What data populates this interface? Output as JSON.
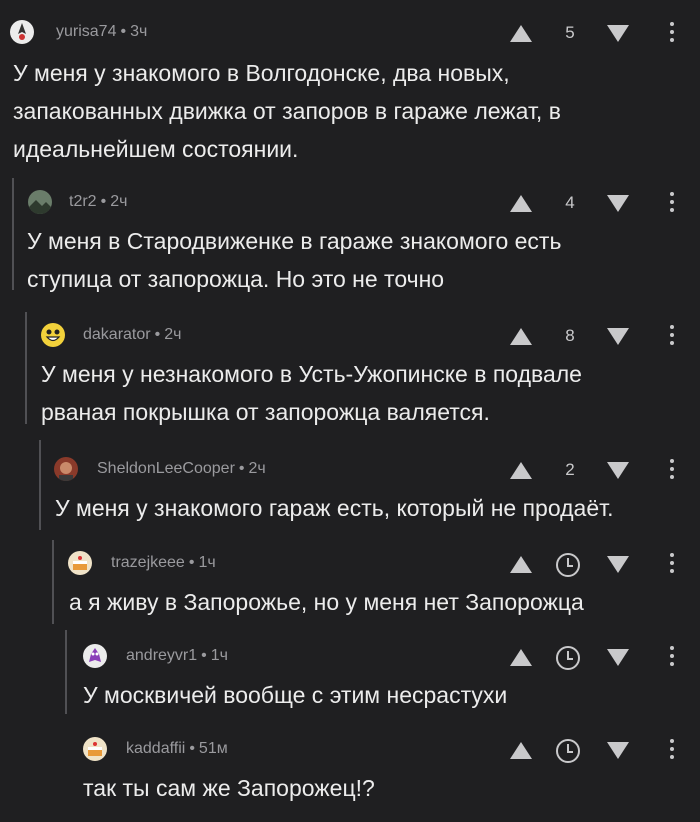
{
  "comments": [
    {
      "author": "yurisa74",
      "time": "3ч",
      "score": "5",
      "text_lines": [
        "У меня у знакомого в Волгодонске, два новых,",
        "запакованных движка от запоров в гараже лежат, в",
        "идеальнейшем состоянии."
      ],
      "avatar_icon": "rocket-avatar-icon"
    },
    {
      "author": "t2r2",
      "time": "2ч",
      "score": "4",
      "text_lines": [
        "У меня в Стародвиженке в гараже знакомого есть",
        "ступица от запорожца. Но это не точно"
      ],
      "avatar_icon": "landscape-avatar-icon"
    },
    {
      "author": "dakarator",
      "time": "2ч",
      "score": "8",
      "text_lines": [
        "У меня у незнакомого в Усть-Ужопинске в подвале",
        "рваная покрышка от запорожца валяется."
      ],
      "avatar_icon": "smiley-avatar-icon"
    },
    {
      "author": "SheldonLeeCooper",
      "time": "2ч",
      "score": "2",
      "text_lines": [
        "У меня у знакомого гараж есть, который не продаёт."
      ],
      "avatar_icon": "face-avatar-icon"
    },
    {
      "author": "trazejkeee",
      "time": "1ч",
      "score": "",
      "text_lines": [
        "а я живу в Запорожье, но у меня нет Запорожца"
      ],
      "avatar_icon": "cake-avatar-icon"
    },
    {
      "author": "andreyvr1",
      "time": "1ч",
      "score": "",
      "text_lines": [
        "У москвичей вообще с этим несрастухи"
      ],
      "avatar_icon": "purple-creature-avatar-icon"
    },
    {
      "author": "kaddaffii",
      "time": "51м",
      "score": "",
      "text_lines": [
        "так ты сам же Запорожец!?"
      ],
      "avatar_icon": "cake-avatar-icon"
    }
  ],
  "separator": "•"
}
